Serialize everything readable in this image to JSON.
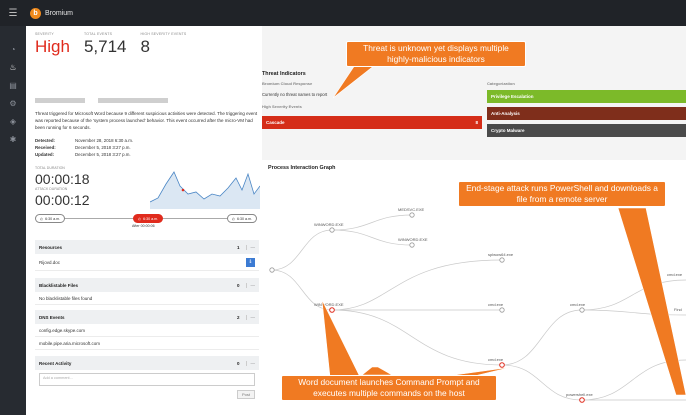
{
  "app": {
    "brand": "Bromium"
  },
  "rail": {
    "icons": [
      "dashboard-icon",
      "fire-icon",
      "clipboard-icon",
      "gear-icon",
      "shield-icon",
      "bug-icon"
    ]
  },
  "stats": [
    {
      "label": "SEVERITY",
      "value": "High",
      "color": "#e02b1d"
    },
    {
      "label": "TOTAL EVENTS",
      "value": "5,714",
      "color": "#333333"
    },
    {
      "label": "HIGH SEVERITY EVENTS",
      "value": "8",
      "color": "#333333"
    }
  ],
  "details": {
    "description": "Threat triggered for Microsoft Word because 9 different suspicious activities were detected. The triggering event was reported because of the 'system process launched' behavior. This event occurred after the micro-VM had been running for 6 seconds.",
    "detected_label": "Detected:",
    "detected": "November 28, 2018 6:30 a.m.",
    "received_label": "Received:",
    "received": "December 5, 2018 3:27 p.m.",
    "updated_label": "Updated:",
    "updated": "December 5, 2018 3:27 p.m."
  },
  "durations": {
    "total_label": "TOTAL DURATION",
    "total": "00:00:18",
    "attack_label": "ATTACK DURATION",
    "attack": "00:00:12"
  },
  "timeline": {
    "start": "6:30 a.m.",
    "mid": "6:30 a.m.",
    "end": "6:30 a.m.",
    "after": "After 00:00:06"
  },
  "resources": {
    "title": "Resources",
    "count": "1",
    "items": [
      "Rijovd.doc"
    ]
  },
  "blacklistable": {
    "title": "Blacklistable Files",
    "count": "0",
    "empty": "No blacklistable files found"
  },
  "dns": {
    "title": "DNS Events",
    "count": "2",
    "items": [
      "config.edge.skype.com",
      "mobile.pipe.aria.microsoft.com"
    ]
  },
  "activity": {
    "title": "Recent Activity",
    "count": "0",
    "placeholder": "Add a comment...",
    "post_label": "Post"
  },
  "threat_indicators": {
    "title": "Threat Indicators",
    "cloud_label": "Bromium Cloud Response",
    "cloud_text": "Currently no threat names to report",
    "high_label": "High Severity Events",
    "high_items": [
      "Cascade"
    ],
    "high_count": "8",
    "category_label": "Categorization",
    "categories": [
      {
        "name": "Privilege Escalation",
        "color": "#7cba29"
      },
      {
        "name": "Anti-Analysis",
        "color": "#7f2e1b"
      },
      {
        "name": "Crypto Malware",
        "color": "#4a4a4a"
      }
    ]
  },
  "process_graph": {
    "title": "Process Interaction Graph",
    "nodes": [
      "WINWORD.EXE",
      "MEDSVC.EXE",
      "WINWORD.EXE",
      "WINWORD.EXE",
      "splwow64.exe",
      "cmd.exe",
      "cmd.exe",
      "cmd.exe",
      "cmd.exe",
      "powershell.exe",
      "cmd.exe",
      "Find",
      "powershell.exe",
      "E[1]"
    ]
  },
  "callouts": {
    "top": "Threat is unknown yet displays multiple highly-malicious indicators",
    "right": "End-stage attack runs PowerShell and downloads a file from a remote server",
    "bottom": "Word document launches Command Prompt and executes multiple commands on the host"
  }
}
